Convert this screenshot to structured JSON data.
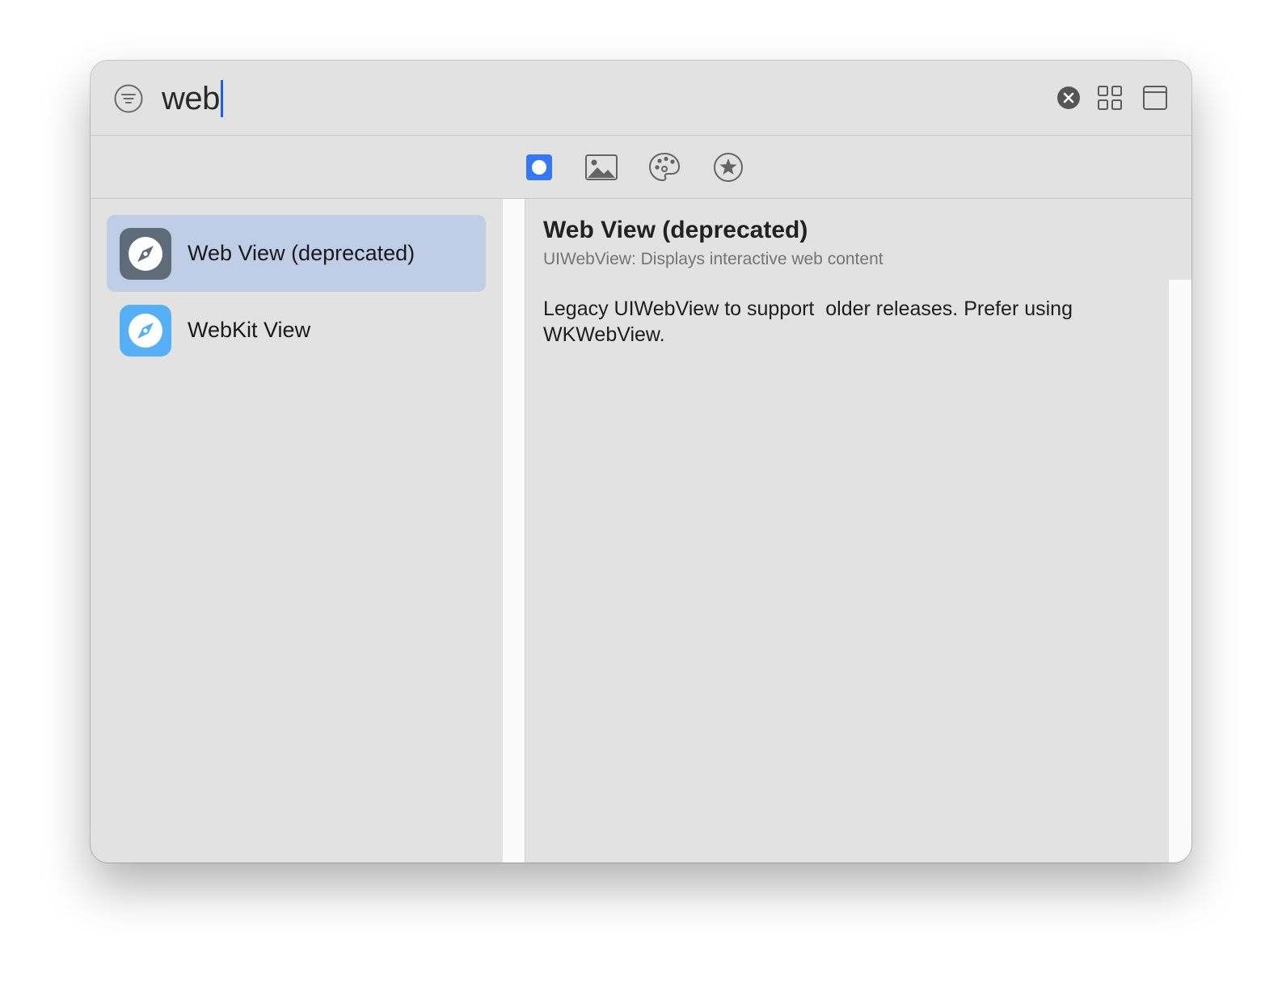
{
  "search": {
    "query": "web"
  },
  "tabs": [
    {
      "name": "views",
      "active": true
    },
    {
      "name": "media",
      "active": false
    },
    {
      "name": "colors",
      "active": false
    },
    {
      "name": "favorites",
      "active": false
    }
  ],
  "results": [
    {
      "label": "Web View (deprecated)",
      "selected": true,
      "icon": "compass-icon",
      "icon_color": "#5f6b78"
    },
    {
      "label": "WebKit View",
      "selected": false,
      "icon": "compass-icon",
      "icon_color": "#55b0f5"
    }
  ],
  "detail": {
    "title": "Web View (deprecated)",
    "subtitle": "UIWebView: Displays interactive web content",
    "body": "Legacy UIWebView to support  older releases. Prefer using\nWKWebView."
  },
  "colors": {
    "accent": "#3478f6",
    "selection": "#bfcee6"
  }
}
